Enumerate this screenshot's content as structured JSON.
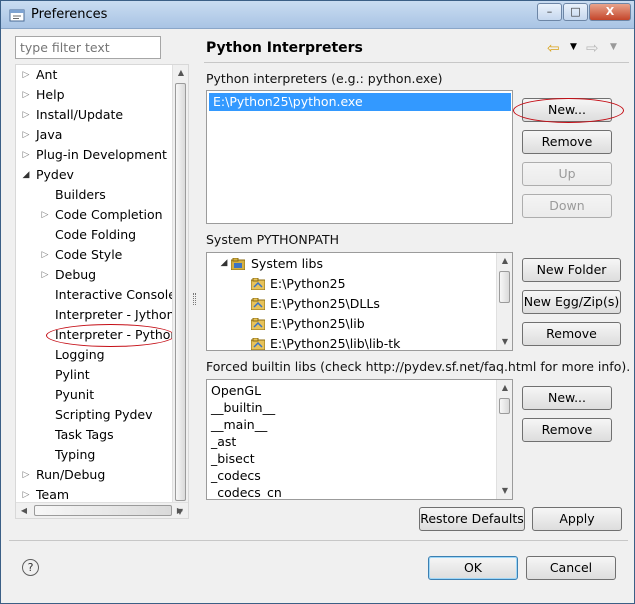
{
  "window": {
    "title": "Preferences",
    "minimize": "–",
    "maximize": "□",
    "close": "X"
  },
  "filter": {
    "placeholder": "type filter text",
    "value": "type filter text"
  },
  "tree": {
    "items": [
      {
        "label": "Ant"
      },
      {
        "label": "Help"
      },
      {
        "label": "Install/Update"
      },
      {
        "label": "Java"
      },
      {
        "label": "Plug-in Development"
      },
      {
        "label": "Pydev"
      },
      {
        "label": "Builders"
      },
      {
        "label": "Code Completion"
      },
      {
        "label": "Code Folding"
      },
      {
        "label": "Code Style"
      },
      {
        "label": "Debug"
      },
      {
        "label": "Interactive Console"
      },
      {
        "label": "Interpreter - Jython"
      },
      {
        "label": "Interpreter - Python"
      },
      {
        "label": "Logging"
      },
      {
        "label": "Pylint"
      },
      {
        "label": "Pyunit"
      },
      {
        "label": "Scripting Pydev"
      },
      {
        "label": "Task Tags"
      },
      {
        "label": "Typing"
      },
      {
        "label": "Run/Debug"
      },
      {
        "label": "Team"
      }
    ],
    "selected": "Interpreter - Python"
  },
  "page": {
    "title": "Python Interpreters",
    "interpreters_label": "Python interpreters (e.g.: python.exe)",
    "interpreters": [
      "E:\\Python25\\python.exe"
    ],
    "interp_buttons": {
      "new": "New...",
      "remove": "Remove",
      "up": "Up",
      "down": "Down"
    },
    "pythonpath_label": "System PYTHONPATH",
    "pythonpath": {
      "root": "System libs",
      "entries": [
        "E:\\Python25",
        "E:\\Python25\\DLLs",
        "E:\\Python25\\lib",
        "E:\\Python25\\lib\\lib-tk"
      ]
    },
    "path_buttons": {
      "new_folder": "New Folder",
      "new_egg": "New Egg/Zip(s)",
      "remove": "Remove"
    },
    "forced_label": "Forced builtin libs (check http://pydev.sf.net/faq.html for more info).",
    "forced": [
      "OpenGL",
      "__builtin__",
      "__main__",
      "_ast",
      "_bisect",
      "_codecs",
      "_codecs_cn"
    ],
    "forced_buttons": {
      "new": "New...",
      "remove": "Remove"
    },
    "restore_defaults": "Restore Defaults",
    "apply": "Apply"
  },
  "dialog": {
    "ok": "OK",
    "cancel": "Cancel",
    "help": "?"
  },
  "colors": {
    "selection": "#3399ff",
    "annotation": "#c40d15"
  }
}
